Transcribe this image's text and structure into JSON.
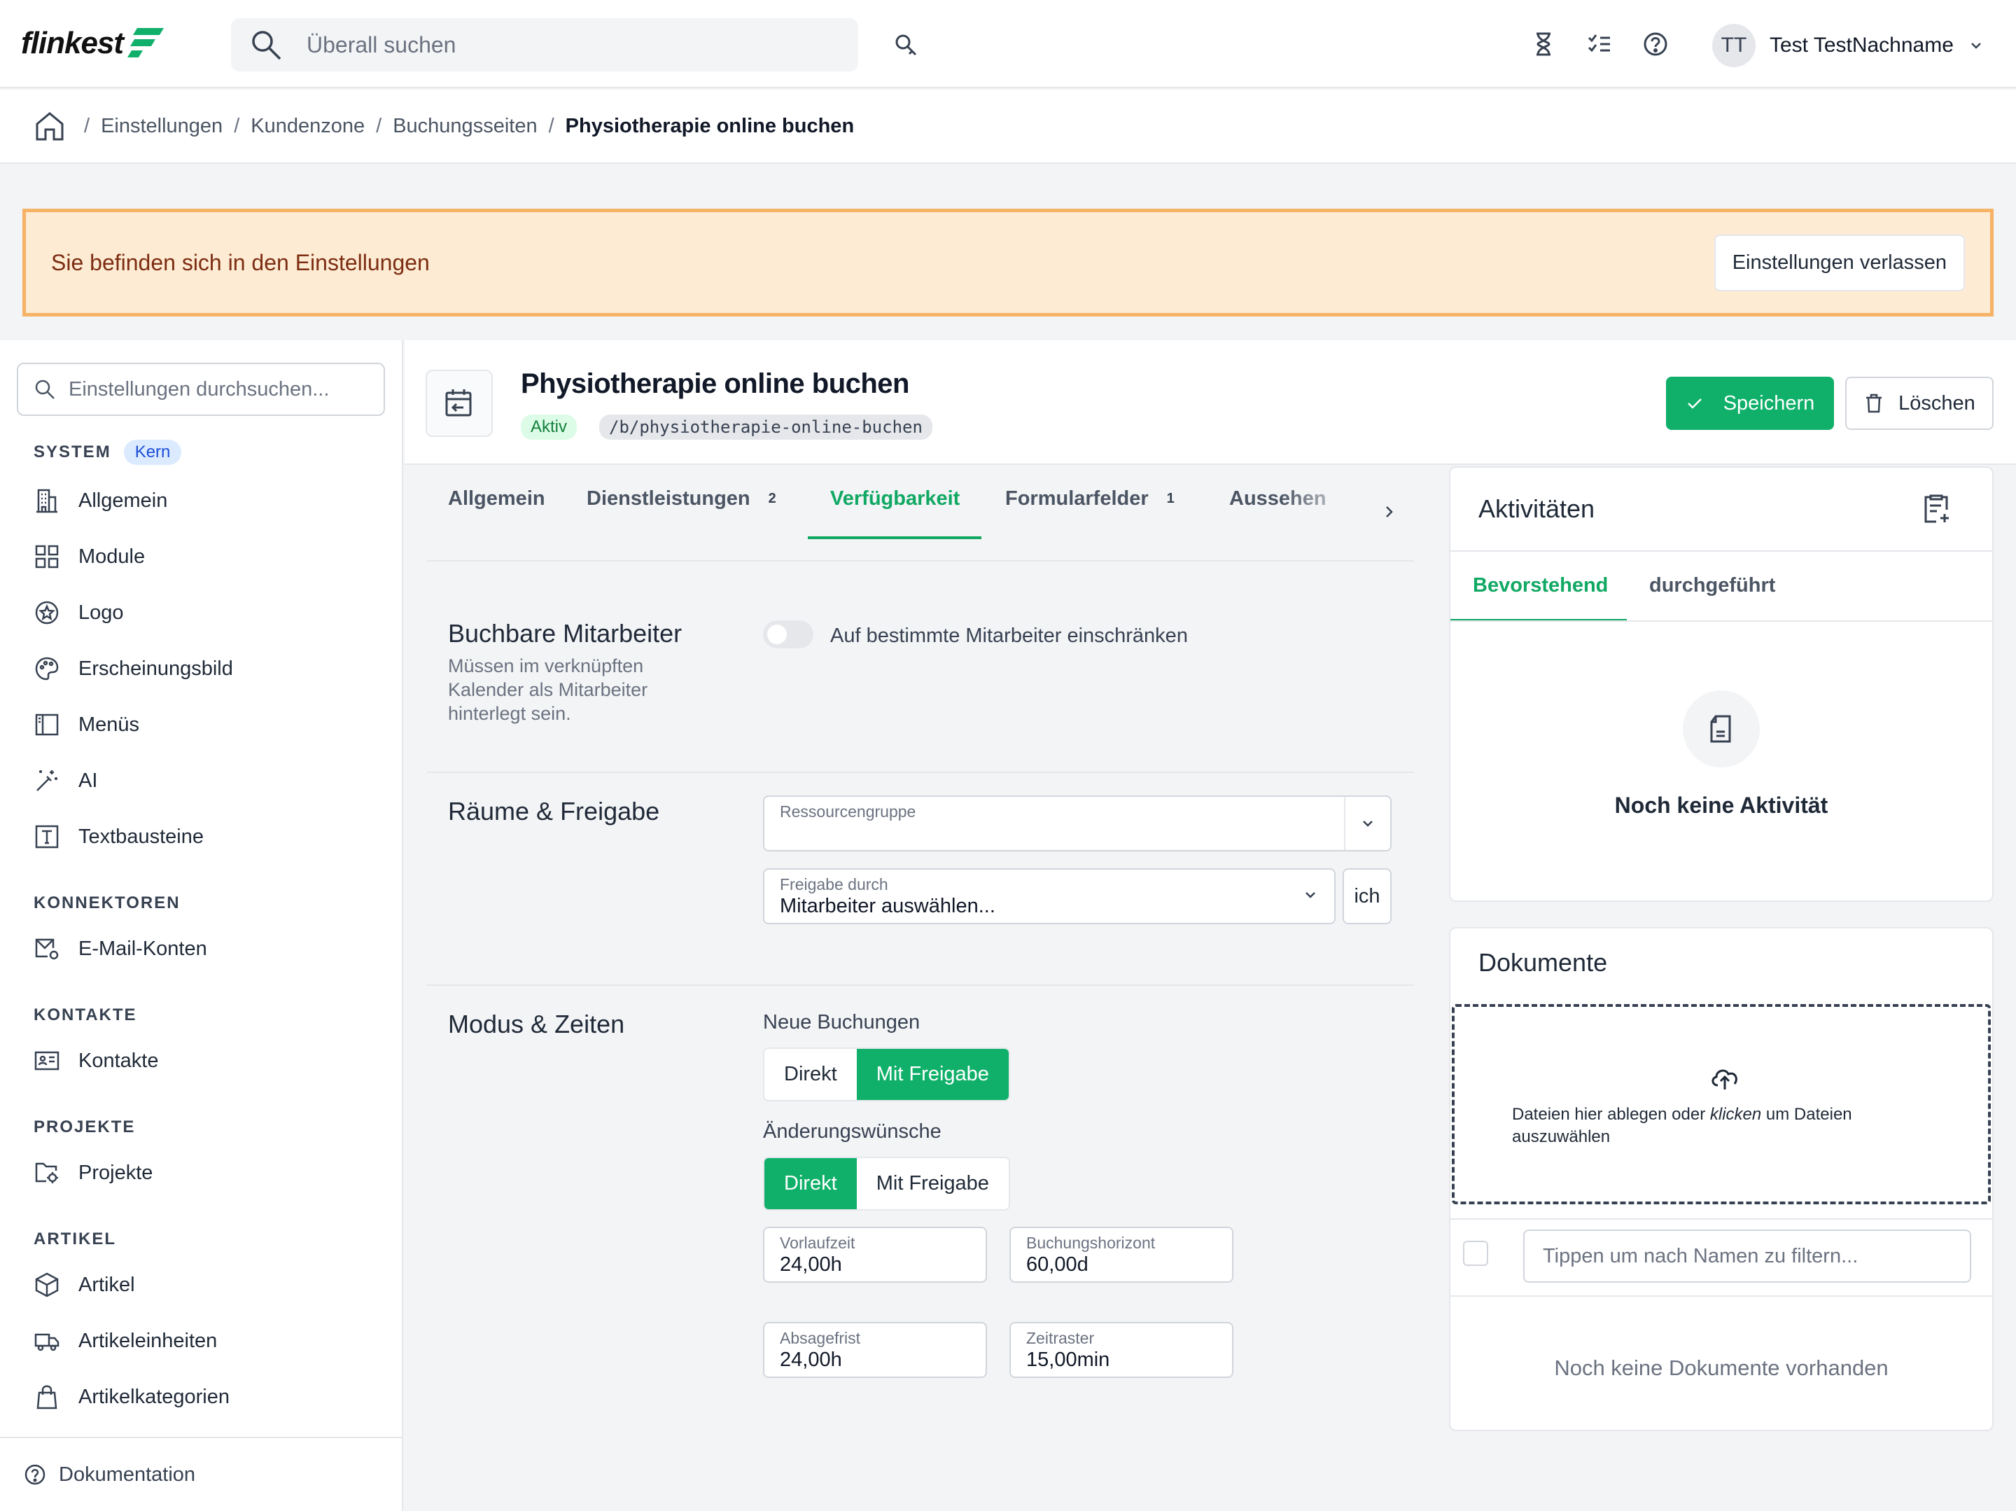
{
  "topbar": {
    "logo_text": "flinkest",
    "search_placeholder": "Überall suchen",
    "user_initials": "TT",
    "user_name": "Test TestNachname"
  },
  "breadcrumb": {
    "items": [
      "Einstellungen",
      "Kundenzone",
      "Buchungsseiten"
    ],
    "current": "Physiotherapie online buchen"
  },
  "notice": {
    "text": "Sie befinden sich in den Einstellungen",
    "button": "Einstellungen verlassen"
  },
  "sidebar": {
    "search_placeholder": "Einstellungen durchsuchen...",
    "sections": {
      "system": "SYSTEM",
      "system_badge": "Kern",
      "konnektoren": "KONNEKTOREN",
      "kontakte": "KONTAKTE",
      "projekte": "PROJEKTE",
      "artikel": "ARTIKEL"
    },
    "items": {
      "allgemein": "Allgemein",
      "module": "Module",
      "logo": "Logo",
      "erscheinungsbild": "Erscheinungsbild",
      "menus": "Menüs",
      "ai": "AI",
      "textbausteine": "Textbausteine",
      "email": "E-Mail-Konten",
      "kontakte": "Kontakte",
      "projekte": "Projekte",
      "artikel": "Artikel",
      "artikeleinheiten": "Artikeleinheiten",
      "artikelkategorien": "Artikelkategorien"
    },
    "footer": "Dokumentation"
  },
  "header": {
    "title": "Physiotherapie online buchen",
    "status": "Aktiv",
    "slug": "/b/physiotherapie-online-buchen",
    "save": "Speichern",
    "delete": "Löschen"
  },
  "tabs": {
    "allgemein": "Allgemein",
    "dienstleistungen": "Dienstleistungen",
    "dienstleistungen_count": "2",
    "verfuegbarkeit": "Verfügbarkeit",
    "formularfelder": "Formularfelder",
    "formularfelder_count": "1",
    "aussehen": "Aussehen"
  },
  "form": {
    "mitarbeiter_title": "Buchbare Mitarbeiter",
    "mitarbeiter_desc": "Müssen im verknüpften Kalender als Mitarbeiter hinterlegt sein.",
    "mitarbeiter_toggle": "Auf bestimmte Mitarbeiter einschränken",
    "raeume_title": "Räume & Freigabe",
    "ressourcengruppe_label": "Ressourcengruppe",
    "freigabe_label": "Freigabe durch",
    "freigabe_value": "Mitarbeiter auswählen...",
    "ich_button": "ich",
    "modus_title": "Modus & Zeiten",
    "neue_buchungen": "Neue Buchungen",
    "aenderungswuensche": "Änderungswünsche",
    "opt_direkt": "Direkt",
    "opt_mit_freigabe": "Mit Freigabe",
    "vorlaufzeit_label": "Vorlaufzeit",
    "vorlaufzeit_value": "24,00h",
    "horizont_label": "Buchungshorizont",
    "horizont_value": "60,00d",
    "absage_label": "Absagefrist",
    "absage_value": "24,00h",
    "raster_label": "Zeitraster",
    "raster_value": "15,00min"
  },
  "activities": {
    "title": "Aktivitäten",
    "tab_upcoming": "Bevorstehend",
    "tab_done": "durchgeführt",
    "empty": "Noch keine Aktivität"
  },
  "documents": {
    "title": "Dokumente",
    "drop_text_1": "Dateien hier ablegen oder ",
    "drop_text_em": "klicken",
    "drop_text_2": " um Dateien auszuwählen",
    "filter_placeholder": "Tippen um nach Namen zu filtern...",
    "empty": "Noch keine Dokumente vorhanden"
  },
  "colors": {
    "accent": "#10b06a",
    "notice_bg": "#fdebd3",
    "notice_border": "#f6b265"
  }
}
